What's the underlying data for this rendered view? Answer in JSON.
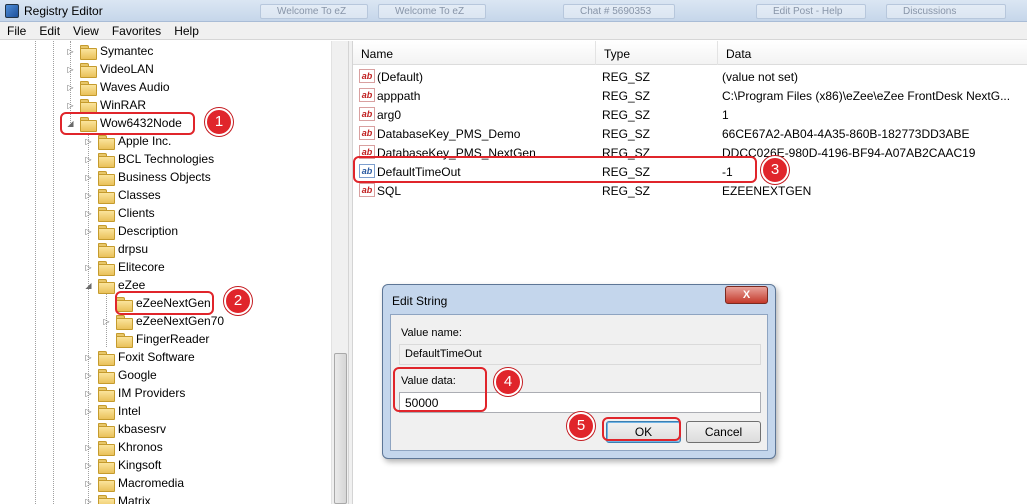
{
  "window": {
    "title": "Registry Editor"
  },
  "ghost_tabs": [
    "Welcome To eZ",
    "Welcome To eZ",
    "Chat # 5690353",
    "Edit Post - Help",
    "Discussions"
  ],
  "menu": [
    "File",
    "Edit",
    "View",
    "Favorites",
    "Help"
  ],
  "tree": {
    "items": [
      {
        "label": "Symantec"
      },
      {
        "label": "VideoLAN"
      },
      {
        "label": "Waves Audio"
      },
      {
        "label": "WinRAR"
      },
      {
        "label": "Wow6432Node"
      },
      {
        "label": "Apple Inc."
      },
      {
        "label": "BCL Technologies"
      },
      {
        "label": "Business Objects"
      },
      {
        "label": "Classes"
      },
      {
        "label": "Clients"
      },
      {
        "label": "Description"
      },
      {
        "label": "drpsu"
      },
      {
        "label": "Elitecore"
      },
      {
        "label": "eZee"
      },
      {
        "label": "eZeeNextGen"
      },
      {
        "label": "eZeeNextGen70"
      },
      {
        "label": "FingerReader"
      },
      {
        "label": "Foxit Software"
      },
      {
        "label": "Google"
      },
      {
        "label": "IM Providers"
      },
      {
        "label": "Intel"
      },
      {
        "label": "kbasesrv"
      },
      {
        "label": "Khronos"
      },
      {
        "label": "Kingsoft"
      },
      {
        "label": "Macromedia"
      },
      {
        "label": "Matrix"
      }
    ]
  },
  "list": {
    "columns": [
      "Name",
      "Type",
      "Data"
    ],
    "rows": [
      {
        "name": "(Default)",
        "type": "REG_SZ",
        "data": "(value not set)",
        "icon": "string-value-icon"
      },
      {
        "name": "apppath",
        "type": "REG_SZ",
        "data": "C:\\Program Files (x86)\\eZee\\eZee FrontDesk NextG...",
        "icon": "string-value-icon"
      },
      {
        "name": "arg0",
        "type": "REG_SZ",
        "data": "1",
        "icon": "string-value-icon"
      },
      {
        "name": "DatabaseKey_PMS_Demo",
        "type": "REG_SZ",
        "data": "66CE67A2-AB04-4A35-860B-182773DD3ABE",
        "icon": "string-value-icon"
      },
      {
        "name": "DatabaseKey_PMS_NextGen",
        "type": "REG_SZ",
        "data": "DDCC026E-980D-4196-BF94-A07AB2CAAC19",
        "icon": "string-value-icon"
      },
      {
        "name": "DefaultTimeOut",
        "type": "REG_SZ",
        "data": "-1",
        "icon": "string-value-selected-icon"
      },
      {
        "name": "SQL",
        "type": "REG_SZ",
        "data": "EZEENEXTGEN",
        "icon": "string-value-icon"
      }
    ]
  },
  "dialog": {
    "title": "Edit String",
    "close": "X",
    "value_name_label": "Value name:",
    "value_name": "DefaultTimeOut",
    "value_data_label": "Value data:",
    "value_data": "50000",
    "ok": "OK",
    "cancel": "Cancel"
  },
  "callouts": [
    "1",
    "2",
    "3",
    "4",
    "5"
  ],
  "colors": {
    "callout": "#e0252b",
    "selection": "#cce8ff"
  }
}
